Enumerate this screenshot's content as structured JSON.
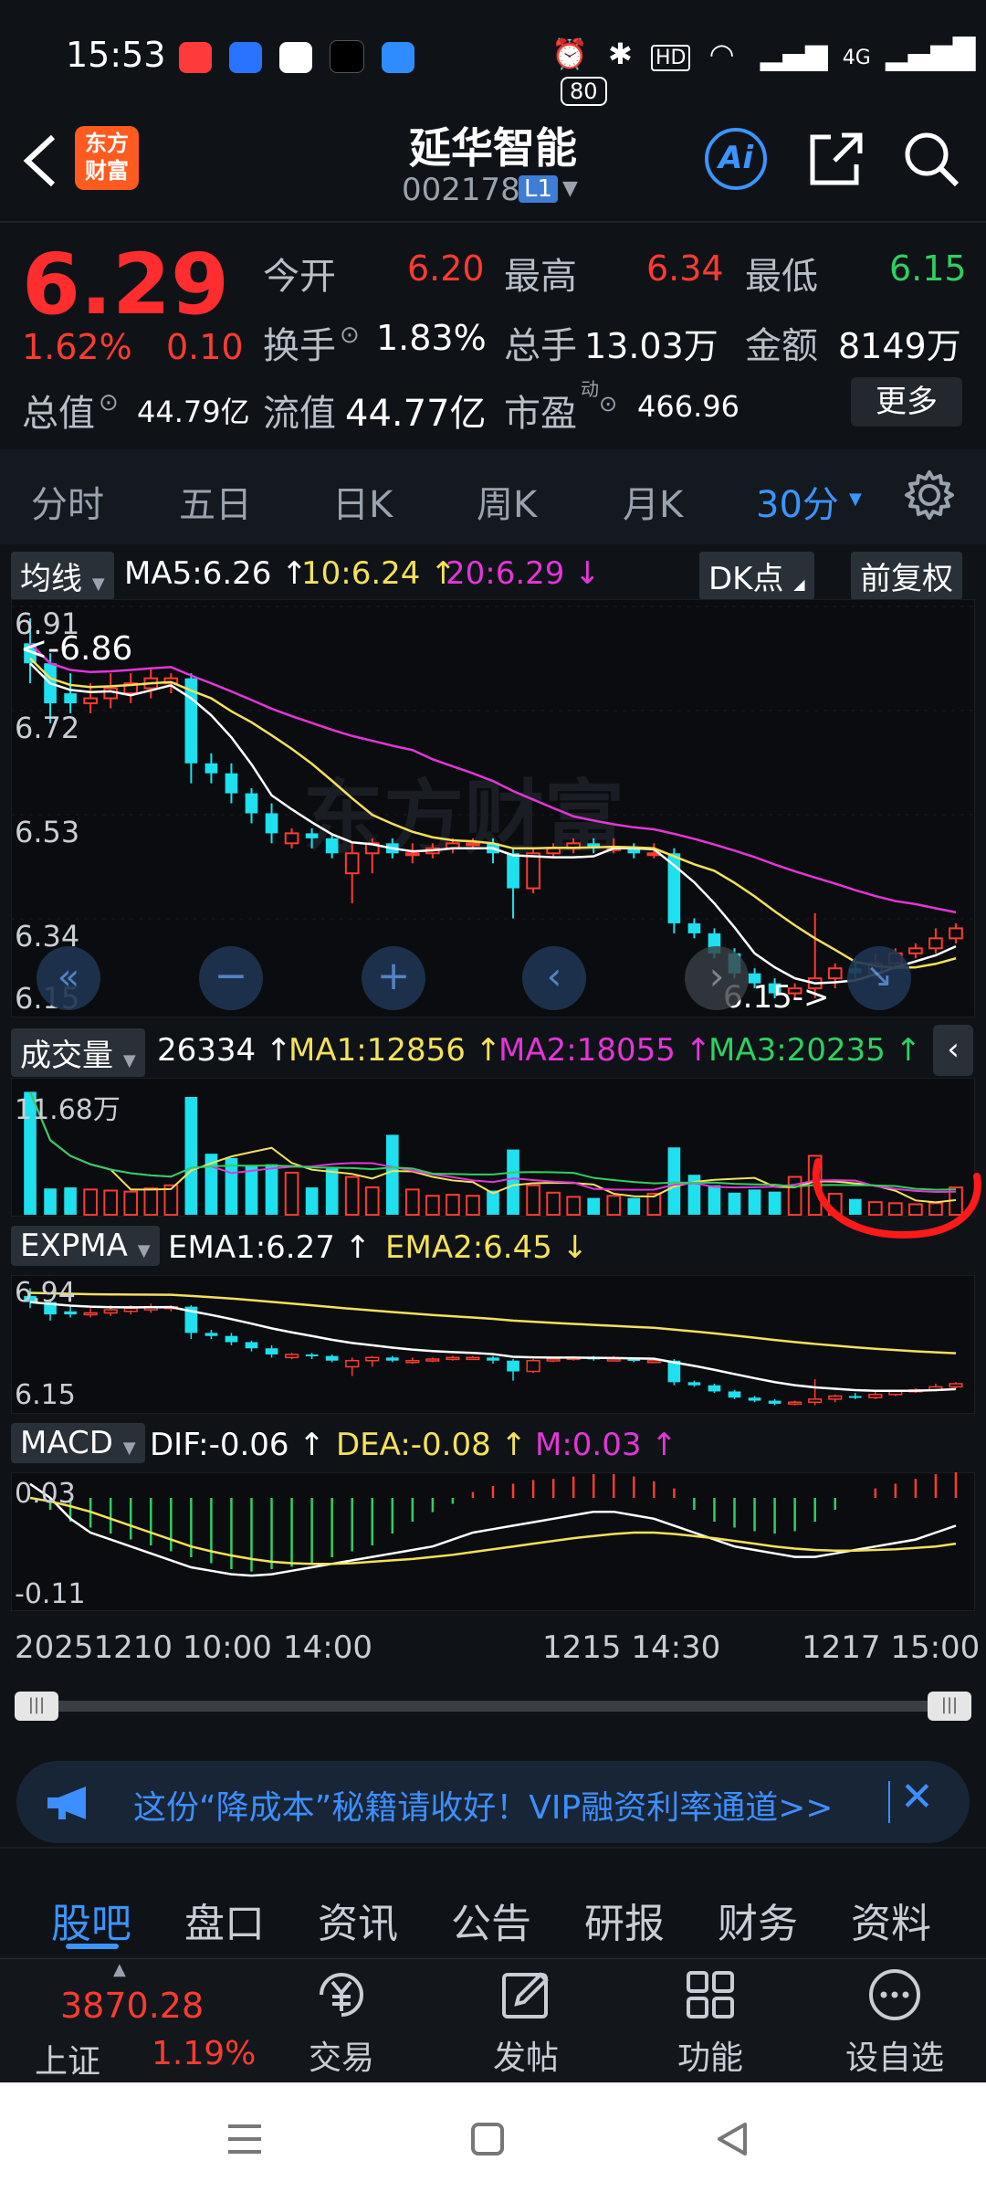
{
  "status_bar": {
    "time": "15:53",
    "battery": "80",
    "network": "4G"
  },
  "header": {
    "title": "延华智能",
    "code": "002178",
    "level_badge": "L1",
    "logo_text_top": "东方",
    "logo_text_bottom": "财富"
  },
  "quote": {
    "price": "6.29",
    "change_pct": "1.62%",
    "change": "0.10",
    "open_label": "今开",
    "open": "6.20",
    "high_label": "最高",
    "high": "6.34",
    "low_label": "最低",
    "low": "6.15",
    "turnover_label": "换手",
    "turnover": "1.83%",
    "volume_label": "总手",
    "volume": "13.03万",
    "amount_label": "金额",
    "amount": "8149万",
    "mktcap_label": "总值",
    "mktcap": "44.79亿",
    "float_label": "流值",
    "float_cap": "44.77亿",
    "pe_label": "市盈",
    "pe_sup": "动",
    "pe": "466.96",
    "more_button": "更多"
  },
  "period_tabs": [
    {
      "label": "分时"
    },
    {
      "label": "五日"
    },
    {
      "label": "日K"
    },
    {
      "label": "周K"
    },
    {
      "label": "月K"
    },
    {
      "label": "30分"
    }
  ],
  "main_chart": {
    "indicator_tag": "均线",
    "ma5": "MA5:6.26 ↑",
    "ma10": "10:6.24 ↑",
    "ma20": "20:6.29 ↓",
    "dk_button": "DK点",
    "adjust_button": "前复权",
    "y_ticks": [
      "6.91",
      "6.72",
      "6.53",
      "6.34",
      "6.15"
    ],
    "high_marker": "<-6.86",
    "low_marker": "6.15->",
    "watermark": "东方财富"
  },
  "volume_chart": {
    "indicator_tag": "成交量",
    "vol": "26334 ↑",
    "ma1": "MA1:12856 ↑",
    "ma2": "MA2:18055 ↑",
    "ma3": "MA3:20235 ↑",
    "y_top": "11.68万"
  },
  "expma_chart": {
    "indicator_tag": "EXPMA",
    "ema1": "EMA1:6.27 ↑",
    "ema2": "EMA2:6.45 ↓",
    "y_top": "6.94",
    "y_bottom": "6.15"
  },
  "macd_chart": {
    "indicator_tag": "MACD",
    "dif": "DIF:-0.06 ↑",
    "dea": "DEA:-0.08 ↑",
    "m": "M:0.03 ↑",
    "y_top": "0.03",
    "y_bottom": "-0.11"
  },
  "time_axis": {
    "left": "20251210 10:00",
    "left2": "14:00",
    "mid": "1215 14:30",
    "right": "1217 15:00"
  },
  "ad_banner": {
    "text": "这份“降成本”秘籍请收好！VIP融资利率通道>>"
  },
  "bottom_tabs": [
    {
      "label": "股吧"
    },
    {
      "label": "盘口"
    },
    {
      "label": "资讯"
    },
    {
      "label": "公告"
    },
    {
      "label": "研报"
    },
    {
      "label": "财务"
    },
    {
      "label": "资料"
    }
  ],
  "bottom_nav": {
    "index_value": "3870.28",
    "index_name": "上证",
    "index_change": "1.19%",
    "items": [
      {
        "label": "交易"
      },
      {
        "label": "发帖"
      },
      {
        "label": "功能"
      },
      {
        "label": "设自选"
      }
    ]
  },
  "colors": {
    "up": "#ff3b30",
    "down": "#2fd060",
    "accent": "#3b95ff",
    "ma5": "#ffffff",
    "ma10": "#f5e15a",
    "ma20": "#e535d8",
    "cyan": "#1ee0ee"
  }
}
